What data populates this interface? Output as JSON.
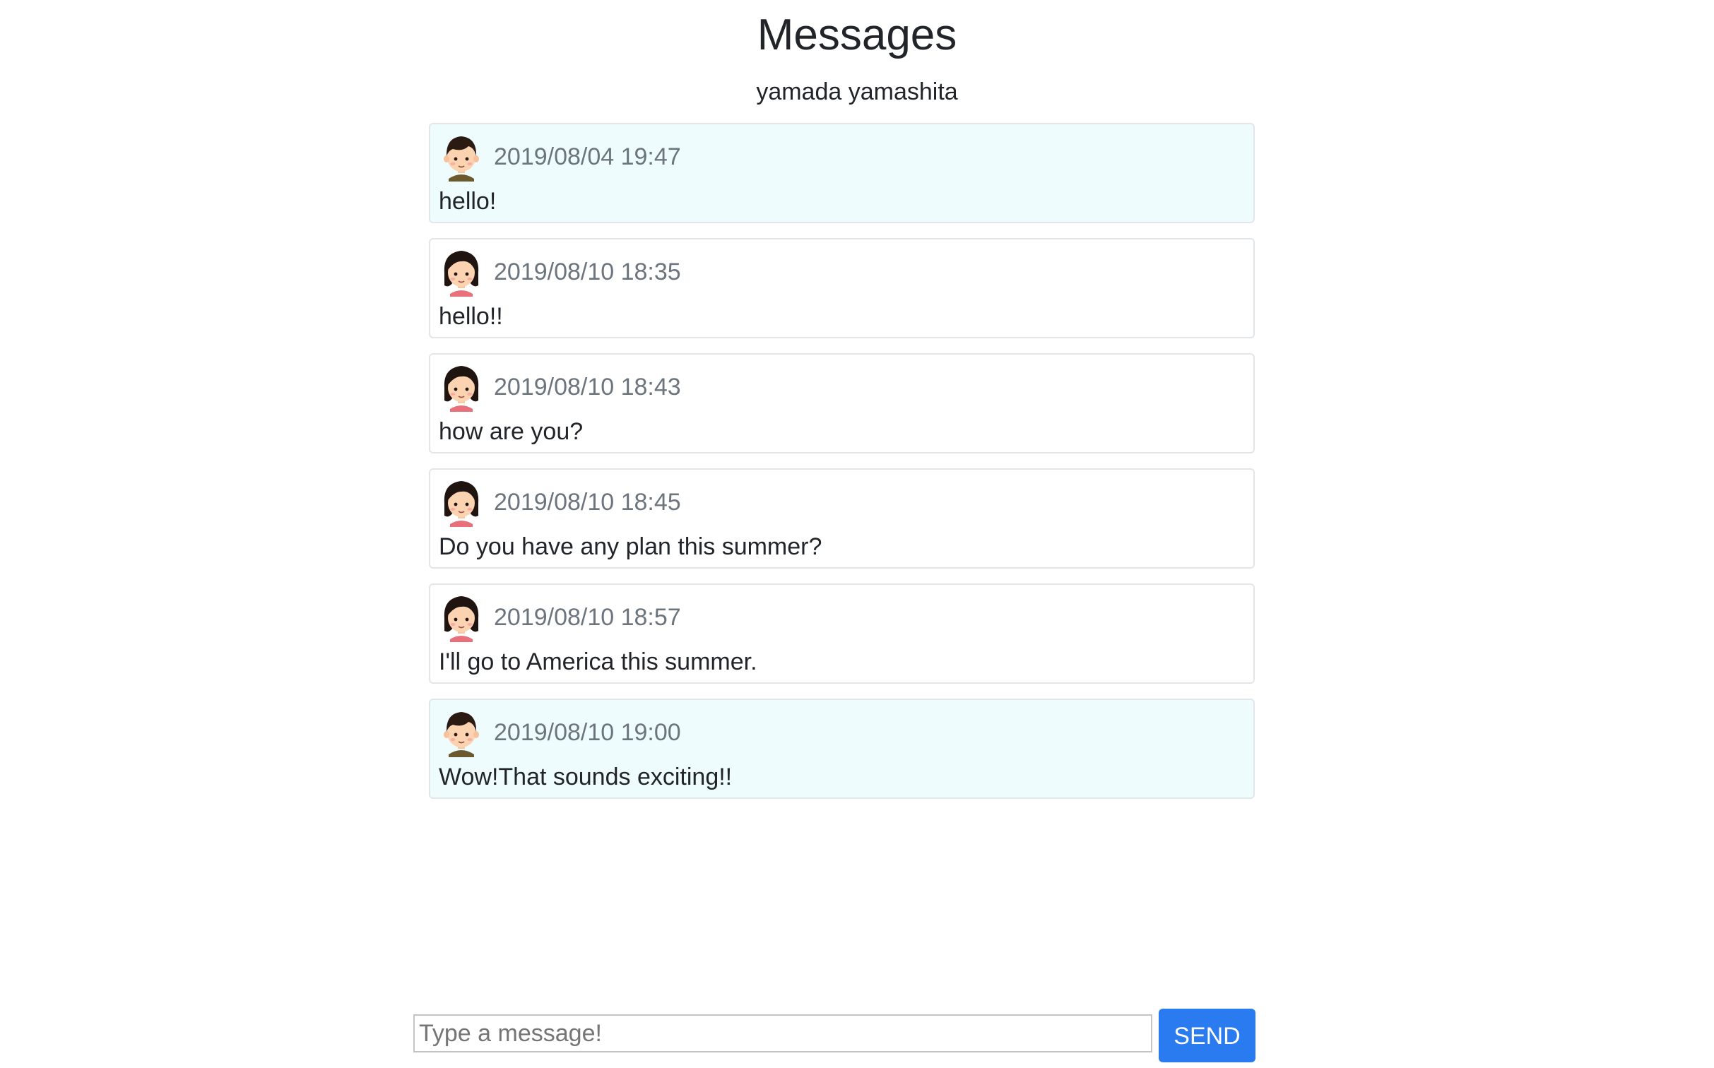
{
  "header": {
    "title": "Messages",
    "partner": "yamada yamashita"
  },
  "messages": [
    {
      "from": "me",
      "avatar": "boy-avatar-icon",
      "time": "2019/08/04 19:47",
      "text": "hello!"
    },
    {
      "from": "partner",
      "avatar": "girl-avatar-icon",
      "time": "2019/08/10 18:35",
      "text": "hello!!"
    },
    {
      "from": "partner",
      "avatar": "girl-avatar-icon",
      "time": "2019/08/10 18:43",
      "text": "how are you?"
    },
    {
      "from": "partner",
      "avatar": "girl-avatar-icon",
      "time": "2019/08/10 18:45",
      "text": "Do you have any plan this summer?"
    },
    {
      "from": "partner",
      "avatar": "girl-avatar-icon",
      "time": "2019/08/10 18:57",
      "text": "I'll go to America this summer."
    },
    {
      "from": "me",
      "avatar": "boy-avatar-icon",
      "time": "2019/08/10 19:00",
      "text": "Wow!That sounds exciting!!"
    }
  ],
  "composer": {
    "placeholder": "Type a message!",
    "value": "",
    "send_label": "SEND"
  },
  "colors": {
    "mine_background": "#effcfd",
    "partner_background": "#ffffff",
    "send_button": "#2b7bf0",
    "timestamp": "#6c757d"
  }
}
